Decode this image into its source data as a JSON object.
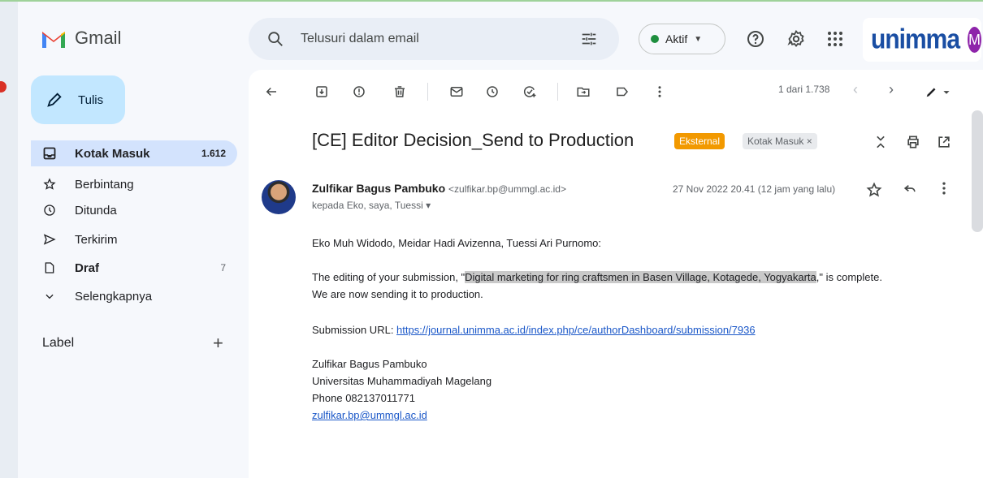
{
  "app": {
    "name": "Gmail"
  },
  "search": {
    "placeholder": "Telusuri dalam email"
  },
  "status": {
    "label": "Aktif",
    "color": "#1e8e3e"
  },
  "org": {
    "name": "unimma",
    "avatar_letter": "M"
  },
  "sidebar": {
    "compose_label": "Tulis",
    "items": [
      {
        "label": "Kotak Masuk",
        "count": "1.612",
        "icon": "inbox-icon"
      },
      {
        "label": "Berbintang",
        "count": "",
        "icon": "star-icon"
      },
      {
        "label": "Ditunda",
        "count": "",
        "icon": "clock-icon"
      },
      {
        "label": "Terkirim",
        "count": "",
        "icon": "send-icon"
      },
      {
        "label": "Draf",
        "count": "7",
        "icon": "draft-icon"
      },
      {
        "label": "Selengkapnya",
        "count": "",
        "icon": "chevron-down-icon"
      }
    ],
    "labels_header": "Label",
    "labels_add": "+"
  },
  "toolbar": {
    "pager": "1 dari 1.738"
  },
  "email": {
    "subject": "[CE] Editor Decision_Send to Production",
    "chip_external": "Eksternal",
    "chip_inbox": "Kotak Masuk ×",
    "sender_name": "Zulfikar Bagus Pambuko",
    "sender_email": "<zulfikar.bp@ummgl.ac.id>",
    "recipients": "kepada Eko, saya, Tuessi ▾",
    "date": "27 Nov 2022 20.41 (12 jam yang lalu)",
    "greeting": "Eko Muh Widodo, Meidar Hadi Avizenna, Tuessi Ari Purnomo:",
    "body_pre": "The editing of your submission, \"",
    "body_title": "Digital marketing for ring craftsmen in Basen Village, Kotagede, Yogyakarta",
    "body_post": ",\" is complete.",
    "body_line2": "We are now sending it to production.",
    "url_label": "Submission URL: ",
    "url": "https://journal.unimma.ac.id/index.php/ce/authorDashboard/submission/7936",
    "sig_name": "Zulfikar Bagus Pambuko",
    "sig_org": "Universitas Muhammadiyah Magelang",
    "sig_phone": "Phone 082137011771",
    "sig_email": "zulfikar.bp@ummgl.ac.id"
  }
}
